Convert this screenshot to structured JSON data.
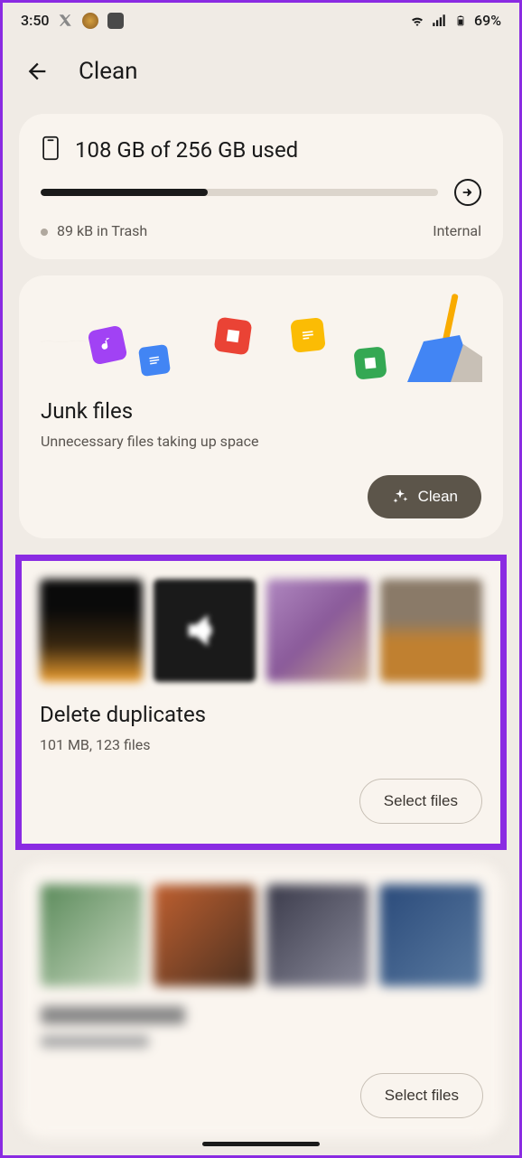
{
  "status": {
    "time": "3:50",
    "battery": "69%"
  },
  "header": {
    "title": "Clean"
  },
  "storage": {
    "usage_text": "108 GB of 256 GB used",
    "progress_percent": 42,
    "trash_text": "89 kB in Trash",
    "location": "Internal"
  },
  "junk": {
    "title": "Junk files",
    "subtitle": "Unnecessary files taking up space",
    "button": "Clean"
  },
  "duplicates": {
    "title": "Delete duplicates",
    "subtitle": "101 MB, 123 files",
    "button": "Select files"
  },
  "memes": {
    "button": "Select files"
  }
}
